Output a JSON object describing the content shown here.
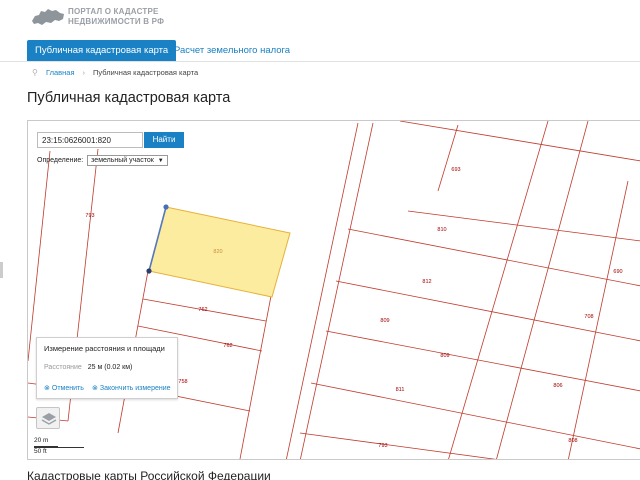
{
  "header": {
    "logo_line1": "ПОРТАЛ О КАДАСТРЕ",
    "logo_line2": "НЕДВИЖИМОСТИ В РФ"
  },
  "nav": {
    "tab_active": "Публичная кадастровая карта",
    "tab_link": "Расчет земельного налога"
  },
  "breadcrumb": {
    "home": "Главная",
    "current": "Публичная кадастровая карта"
  },
  "page_title": "Публичная кадастровая карта",
  "search": {
    "value": "23:15:0626001:820",
    "button": "Найти",
    "definition_label": "Определение:",
    "definition_value": "земельный участок"
  },
  "measure": {
    "title": "Измерение расстояния и площади",
    "distance_label": "Расстояние",
    "distance_value": "25 м (0.02 км)",
    "cancel": "Отменить",
    "finish": "Закончить измерение"
  },
  "scale": {
    "metric": "20 m",
    "imperial": "50 ft"
  },
  "parcels": [
    "793",
    "820",
    "762",
    "762",
    "758",
    "693",
    "810",
    "812",
    "690",
    "809",
    "809",
    "708",
    "806",
    "811",
    "793",
    "808"
  ],
  "colors": {
    "accent": "#1a82c4",
    "parcel_line": "#c0392b",
    "parcel_label": "#a00000",
    "selected_fill": "#fbeca0",
    "selected_border": "#e8b13a",
    "measure_line": "#5577bb"
  },
  "section_title": "Кадастровые карты Российской Федерации"
}
